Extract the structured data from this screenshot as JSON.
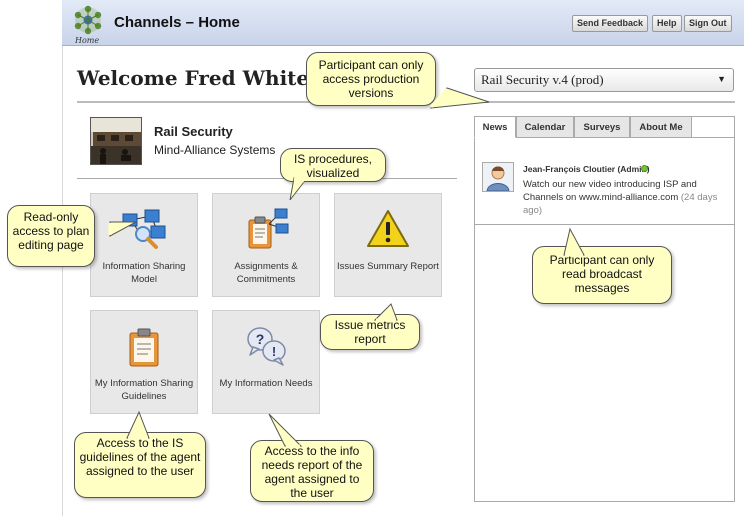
{
  "header": {
    "title": "Channels – Home",
    "logo_caption": "Home",
    "buttons": {
      "feedback": "Send Feedback",
      "help": "Help",
      "sign_out": "Sign Out"
    }
  },
  "welcome": "Welcome Fred White!",
  "plan_selector": {
    "value": "Rail Security v.4 (prod)"
  },
  "plan": {
    "name": "Rail Security",
    "organization": "Mind-Alliance Systems"
  },
  "tiles": {
    "info_sharing_model": "Information Sharing Model",
    "assignments": "Assignments & Commitments",
    "issues_summary": "Issues Summary Report",
    "sharing_guidelines": "My Information Sharing Guidelines",
    "info_needs": "My Information Needs"
  },
  "tabs": {
    "news": "News",
    "calendar": "Calendar",
    "surveys": "Surveys",
    "about": "About Me"
  },
  "news": {
    "author": "Jean-François Cloutier (Admin)",
    "text": "Watch our new video introducing ISP and Channels on www.mind-alliance.com",
    "age": "(24 days ago)"
  },
  "callouts": {
    "production": "Participant can only access production versions",
    "is_procedures": "IS procedures, visualized",
    "read_only": "Read-only access to plan editing page",
    "broadcast": "Participant can only read broadcast messages",
    "issue_metrics": "Issue metrics report",
    "guidelines": "Access to the IS guidelines of the agent assigned to the user",
    "info_needs": "Access to the info needs report of the agent assigned to the user"
  },
  "colors": {
    "header_gradient_top": "#e3eaf7",
    "header_gradient_bottom": "#c8d4ea",
    "callout_fill": "#ffffc4",
    "tile_bg": "#e8e8e8",
    "online": "#77c23c"
  }
}
